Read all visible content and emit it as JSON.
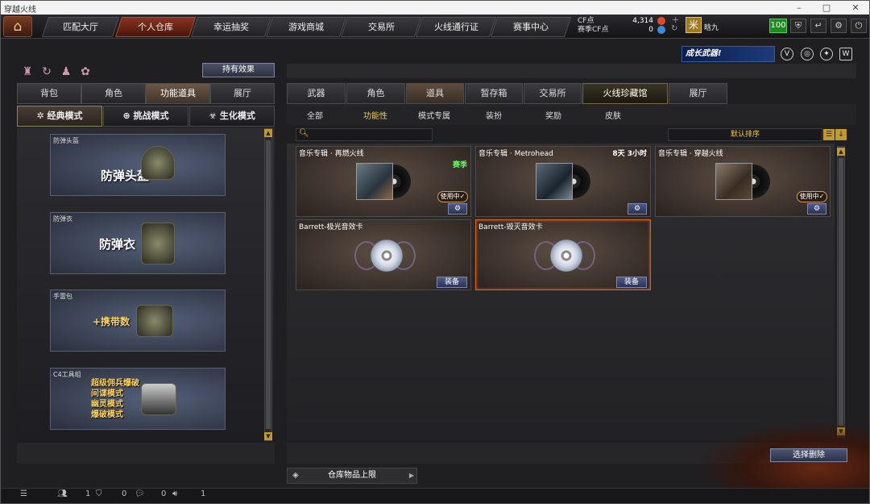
{
  "window": {
    "title": "穿越火线"
  },
  "nav": {
    "tabs": [
      "匹配大厅",
      "个人仓库",
      "幸运抽奖",
      "游戏商城",
      "交易所",
      "火线通行证",
      "赛事中心"
    ],
    "active_index": 1
  },
  "currency": {
    "cf_label": "CF点",
    "cf_value": "4,314",
    "season_label": "赛季CF点",
    "season_value": "0"
  },
  "user": {
    "rank_glyph": "米",
    "name": "晗九",
    "level": "100"
  },
  "left": {
    "hold_effect": "持有效果",
    "tabs": [
      "背包",
      "角色",
      "功能道具",
      "展厅"
    ],
    "active_tab": 2,
    "modes": [
      "经典模式",
      "挑战模式",
      "生化模式"
    ],
    "active_mode": 0,
    "cards": [
      {
        "caption": "防弹头盔",
        "title": "防弹头盔"
      },
      {
        "caption": "防弹衣",
        "title": "防弹衣"
      },
      {
        "caption": "手雷包",
        "title": "+携带数"
      },
      {
        "caption": "C4工具组",
        "lines": [
          "超级佣兵爆破",
          "间谍模式",
          "幽灵模式",
          "爆破模式"
        ]
      }
    ]
  },
  "right": {
    "banner": "成长武器!",
    "tabs": [
      "武器",
      "角色",
      "道具",
      "暂存箱",
      "交易所",
      "火线珍藏馆",
      "展厅"
    ],
    "active_tab": 2,
    "filters": [
      "全部",
      "功能性",
      "模式专属",
      "装扮",
      "奖励",
      "皮肤"
    ],
    "active_filter": 1,
    "search_placeholder": "",
    "sort": "默认排序",
    "items": [
      {
        "name": "音乐专辑 · 再燃火线",
        "tag": "赛季",
        "inuse": "使用中✓"
      },
      {
        "name": "音乐专辑 · Metrohead",
        "time": "8天 3小时"
      },
      {
        "name": "音乐专辑 · 穿越火线",
        "inuse": "使用中✓"
      },
      {
        "name": "Barrett-极光音效卡",
        "equip": "装备"
      },
      {
        "name": "Barrett-毁灭音效卡",
        "equip": "装备"
      }
    ],
    "delete_button": "选择删除",
    "capacity": "仓库物品上限"
  },
  "bottom": {
    "c1": "1",
    "c2": "0",
    "c3": "0",
    "c4": "1"
  }
}
